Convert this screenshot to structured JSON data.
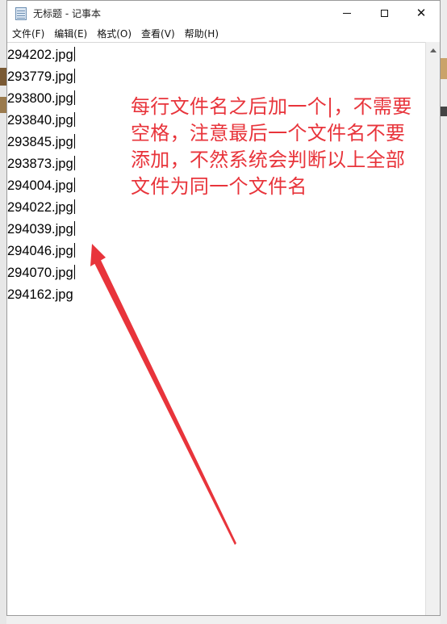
{
  "window": {
    "title": "无标题 - 记事本"
  },
  "menu": [
    {
      "label": "文件(F)"
    },
    {
      "label": "编辑(E)"
    },
    {
      "label": "格式(O)"
    },
    {
      "label": "查看(V)"
    },
    {
      "label": "帮助(H)"
    }
  ],
  "editor": {
    "lines": [
      "294202.jpg",
      "293779.jpg",
      "293800.jpg",
      "293840.jpg",
      "293845.jpg",
      "293873.jpg",
      "294004.jpg",
      "294022.jpg",
      "294039.jpg",
      "294046.jpg",
      "294070.jpg",
      "294162.jpg"
    ]
  },
  "annotation": {
    "lines": [
      "每行文件名之后加一个|，不需要",
      "空格，注意最后一个文件名不要",
      "添加，不然系统会判断以上全部",
      "文件为同一个文件名"
    ],
    "color": "#e8343b"
  },
  "icons": {
    "app": "notepad-icon",
    "minimize": "minimize-icon",
    "maximize": "maximize-icon",
    "close": "close-icon",
    "scroll_up": "scroll-up-arrow-icon"
  }
}
